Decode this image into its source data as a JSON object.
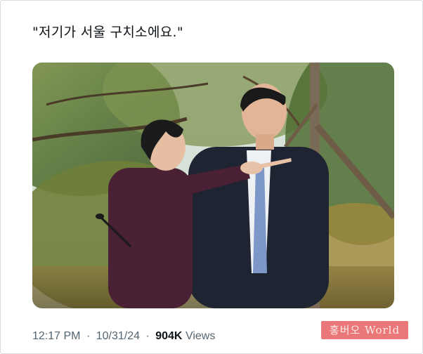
{
  "post": {
    "text": "\"저기가 서울 구치소에요.\""
  },
  "meta": {
    "time": "12:17 PM",
    "separator": "·",
    "date": "10/31/24",
    "views_count": "904K",
    "views_label": "Views"
  },
  "watermark": {
    "text": "홍버오 World",
    "color": "#e86060"
  },
  "media": {
    "description_icon": "photo"
  }
}
